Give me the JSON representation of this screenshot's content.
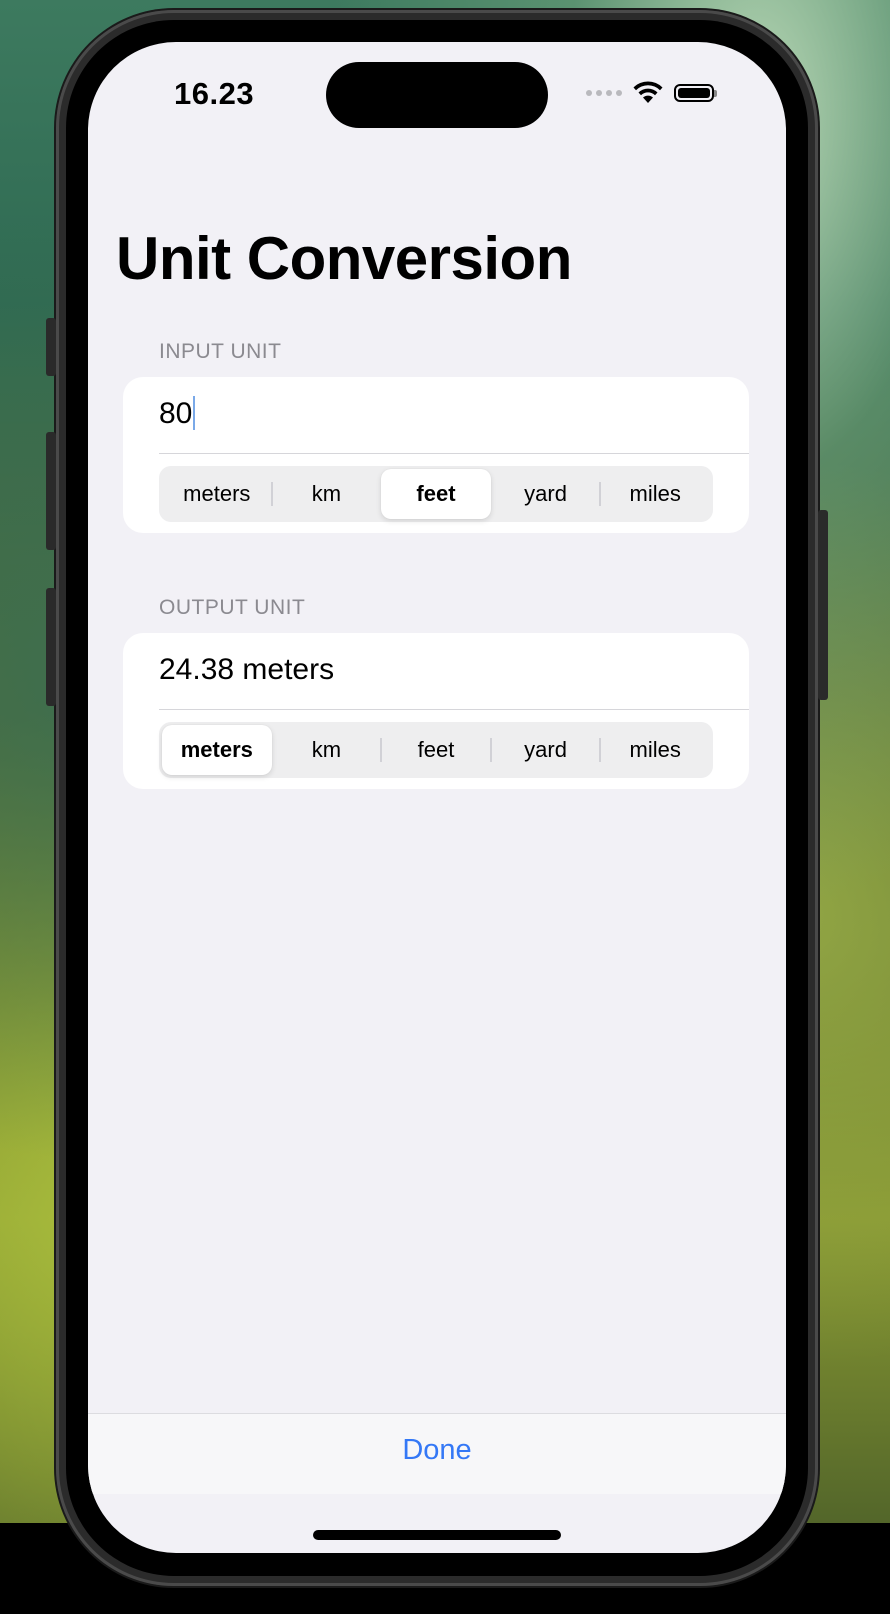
{
  "status_bar": {
    "time": "16.23",
    "icons": [
      "cellular-dots-icon",
      "wifi-icon",
      "battery-icon"
    ]
  },
  "screen": {
    "title": "Unit Conversion",
    "input": {
      "header": "INPUT UNIT",
      "value": "80",
      "units": [
        "meters",
        "km",
        "feet",
        "yard",
        "miles"
      ],
      "selected_unit": "feet"
    },
    "output": {
      "header": "OUTPUT UNIT",
      "value": "24.38 meters",
      "units": [
        "meters",
        "km",
        "feet",
        "yard",
        "miles"
      ],
      "selected_unit": "meters"
    },
    "toolbar": {
      "done_label": "Done"
    }
  },
  "colors": {
    "accent": "#3478f6",
    "background": "#f2f1f6",
    "card": "#ffffff",
    "section_header": "#8b8a90"
  }
}
